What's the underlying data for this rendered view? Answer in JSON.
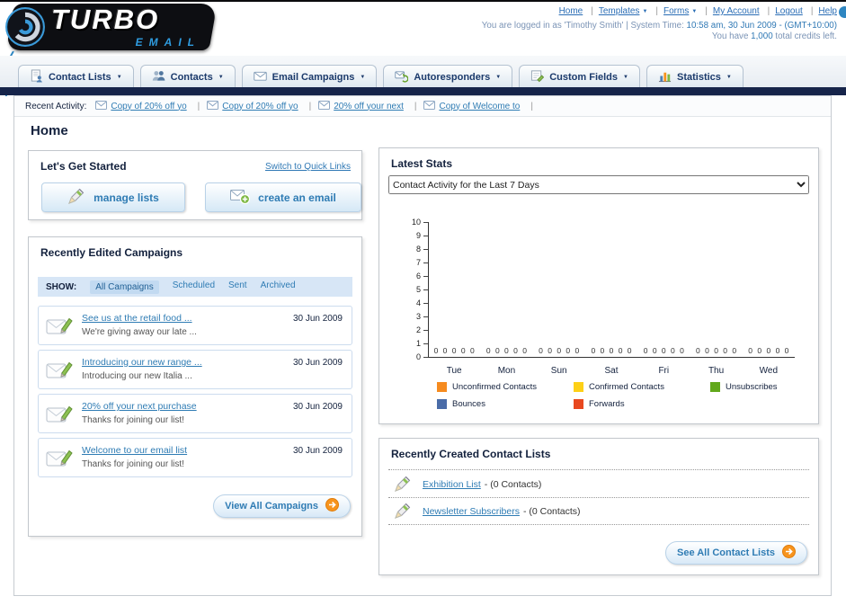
{
  "page_title": "Home",
  "header": {
    "logo_line1": "TURBO",
    "logo_line2": "EMAIL",
    "top_links": [
      {
        "label": "Home",
        "dropdown": false
      },
      {
        "label": "Templates",
        "dropdown": true
      },
      {
        "label": "Forms",
        "dropdown": true
      },
      {
        "label": "My Account",
        "dropdown": false
      },
      {
        "label": "Logout",
        "dropdown": false
      },
      {
        "label": "Help",
        "dropdown": false
      }
    ],
    "session_prefix": "You are logged in as 'Timothy Smith' | System Time:",
    "session_time": "10:58 am, 30 Jun 2009 - (GMT+10:00)",
    "credits_prefix": "You have",
    "credits_value": "1,000",
    "credits_suffix": "total credits left."
  },
  "main_nav": [
    {
      "label": "Contact Lists",
      "icon": "contact-lists"
    },
    {
      "label": "Contacts",
      "icon": "contacts"
    },
    {
      "label": "Email Campaigns",
      "icon": "email-campaigns"
    },
    {
      "label": "Autoresponders",
      "icon": "autoresponders"
    },
    {
      "label": "Custom Fields",
      "icon": "custom-fields"
    },
    {
      "label": "Statistics",
      "icon": "statistics"
    }
  ],
  "recent_activity": {
    "label": "Recent Activity:",
    "items": [
      "Copy of 20% off yo",
      "Copy of 20% off yo",
      "20% off your next",
      "Copy of Welcome to"
    ]
  },
  "get_started": {
    "title": "Let's Get Started",
    "switch_link": "Switch to Quick Links",
    "buttons": [
      {
        "label": "manage lists",
        "icon": "pencil-write"
      },
      {
        "label": "create an email",
        "icon": "email-plus"
      }
    ]
  },
  "campaigns": {
    "title": "Recently Edited Campaigns",
    "show_label": "SHOW:",
    "filters": [
      {
        "label": "All Campaigns",
        "selected": true
      },
      {
        "label": "Scheduled",
        "selected": false
      },
      {
        "label": "Sent",
        "selected": false
      },
      {
        "label": "Archived",
        "selected": false
      }
    ],
    "items": [
      {
        "title": "See us at the retail food ...",
        "subtitle": "We're giving away our late ...",
        "date": "30 Jun 2009"
      },
      {
        "title": "Introducing our new range ...",
        "subtitle": "Introducing our new Italia ...",
        "date": "30 Jun 2009"
      },
      {
        "title": "20% off your next purchase",
        "subtitle": "Thanks for joining our list!",
        "date": "30 Jun 2009"
      },
      {
        "title": "Welcome to our email list",
        "subtitle": "Thanks for joining our list!",
        "date": "30 Jun 2009"
      }
    ],
    "view_all_label": "View All Campaigns"
  },
  "latest_stats": {
    "title": "Latest Stats",
    "period_selected": "Contact Activity for the Last 7 Days"
  },
  "chart_data": {
    "type": "bar",
    "title": "Contact Activity for the Last 7 Days",
    "categories": [
      "Tue",
      "Mon",
      "Sun",
      "Sat",
      "Fri",
      "Thu",
      "Wed"
    ],
    "series": [
      {
        "name": "Unconfirmed Contacts",
        "color": "#f68b1f",
        "values": [
          0,
          0,
          0,
          0,
          0,
          0,
          0
        ]
      },
      {
        "name": "Confirmed Contacts",
        "color": "#fdd017",
        "values": [
          0,
          0,
          0,
          0,
          0,
          0,
          0
        ]
      },
      {
        "name": "Unsubscribes",
        "color": "#62a81c",
        "values": [
          0,
          0,
          0,
          0,
          0,
          0,
          0
        ]
      },
      {
        "name": "Bounces",
        "color": "#4a6ca8",
        "values": [
          0,
          0,
          0,
          0,
          0,
          0,
          0
        ]
      },
      {
        "name": "Forwards",
        "color": "#e8481f",
        "values": [
          0,
          0,
          0,
          0,
          0,
          0,
          0
        ]
      }
    ],
    "ylim": [
      0,
      10
    ],
    "yticks": [
      0,
      1,
      2,
      3,
      4,
      5,
      6,
      7,
      8,
      9,
      10
    ],
    "grid": false,
    "legend_position": "bottom"
  },
  "contact_lists_panel": {
    "title": "Recently Created Contact Lists",
    "items": [
      {
        "name": "Exhibition List",
        "suffix": "- (0 Contacts)"
      },
      {
        "name": "Newsletter Subscribers",
        "suffix": "- (0 Contacts)"
      }
    ],
    "see_all_label": "See All Contact Lists"
  }
}
